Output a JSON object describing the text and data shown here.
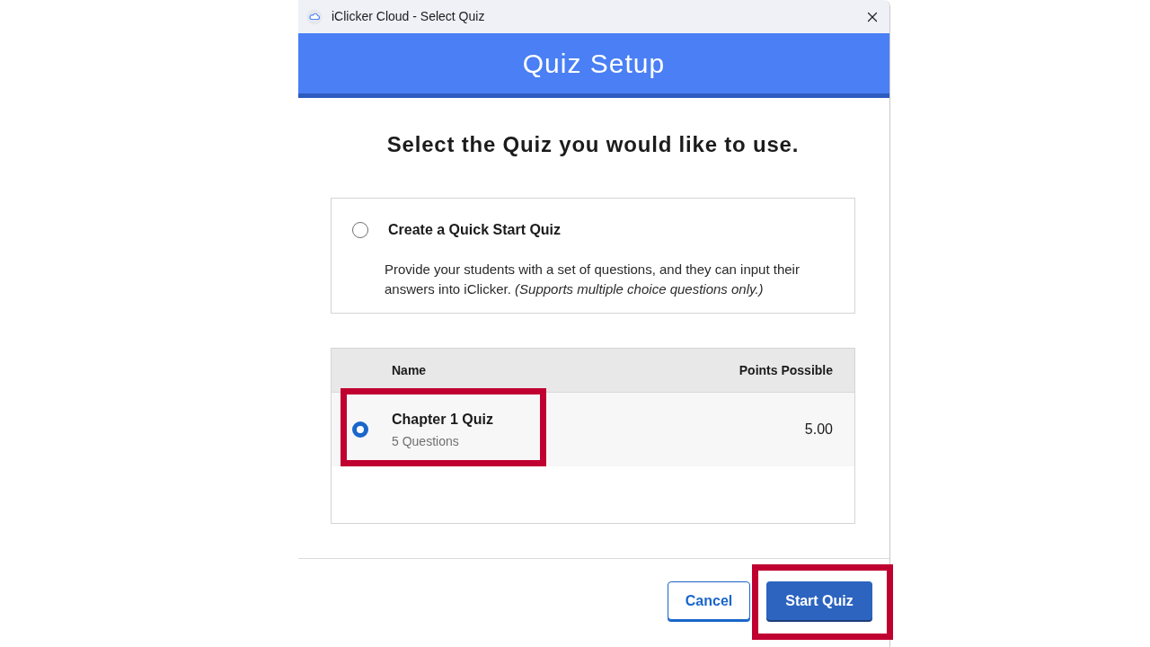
{
  "window": {
    "title": "iClicker Cloud - Select Quiz"
  },
  "header": {
    "title": "Quiz Setup"
  },
  "prompt": "Select the Quiz you would like to use.",
  "quick_start": {
    "title": "Create a Quick Start Quiz",
    "description": "Provide your students with a set of questions, and they can input their answers into iClicker. *(Supports multiple choice questions only.)*",
    "selected": false,
    "highlighted": false
  },
  "table": {
    "columns": [
      "Name",
      "Points Possible"
    ],
    "rows": [
      {
        "name": "Chapter 1 Quiz",
        "detail": "5 Questions",
        "points": "5.00",
        "selected": true,
        "highlighted": true
      }
    ]
  },
  "buttons": [
    {
      "label": "Cancel",
      "kind": "secondary",
      "highlighted": false
    },
    {
      "label": "Start Quiz",
      "kind": "primary",
      "highlighted": true
    }
  ]
}
